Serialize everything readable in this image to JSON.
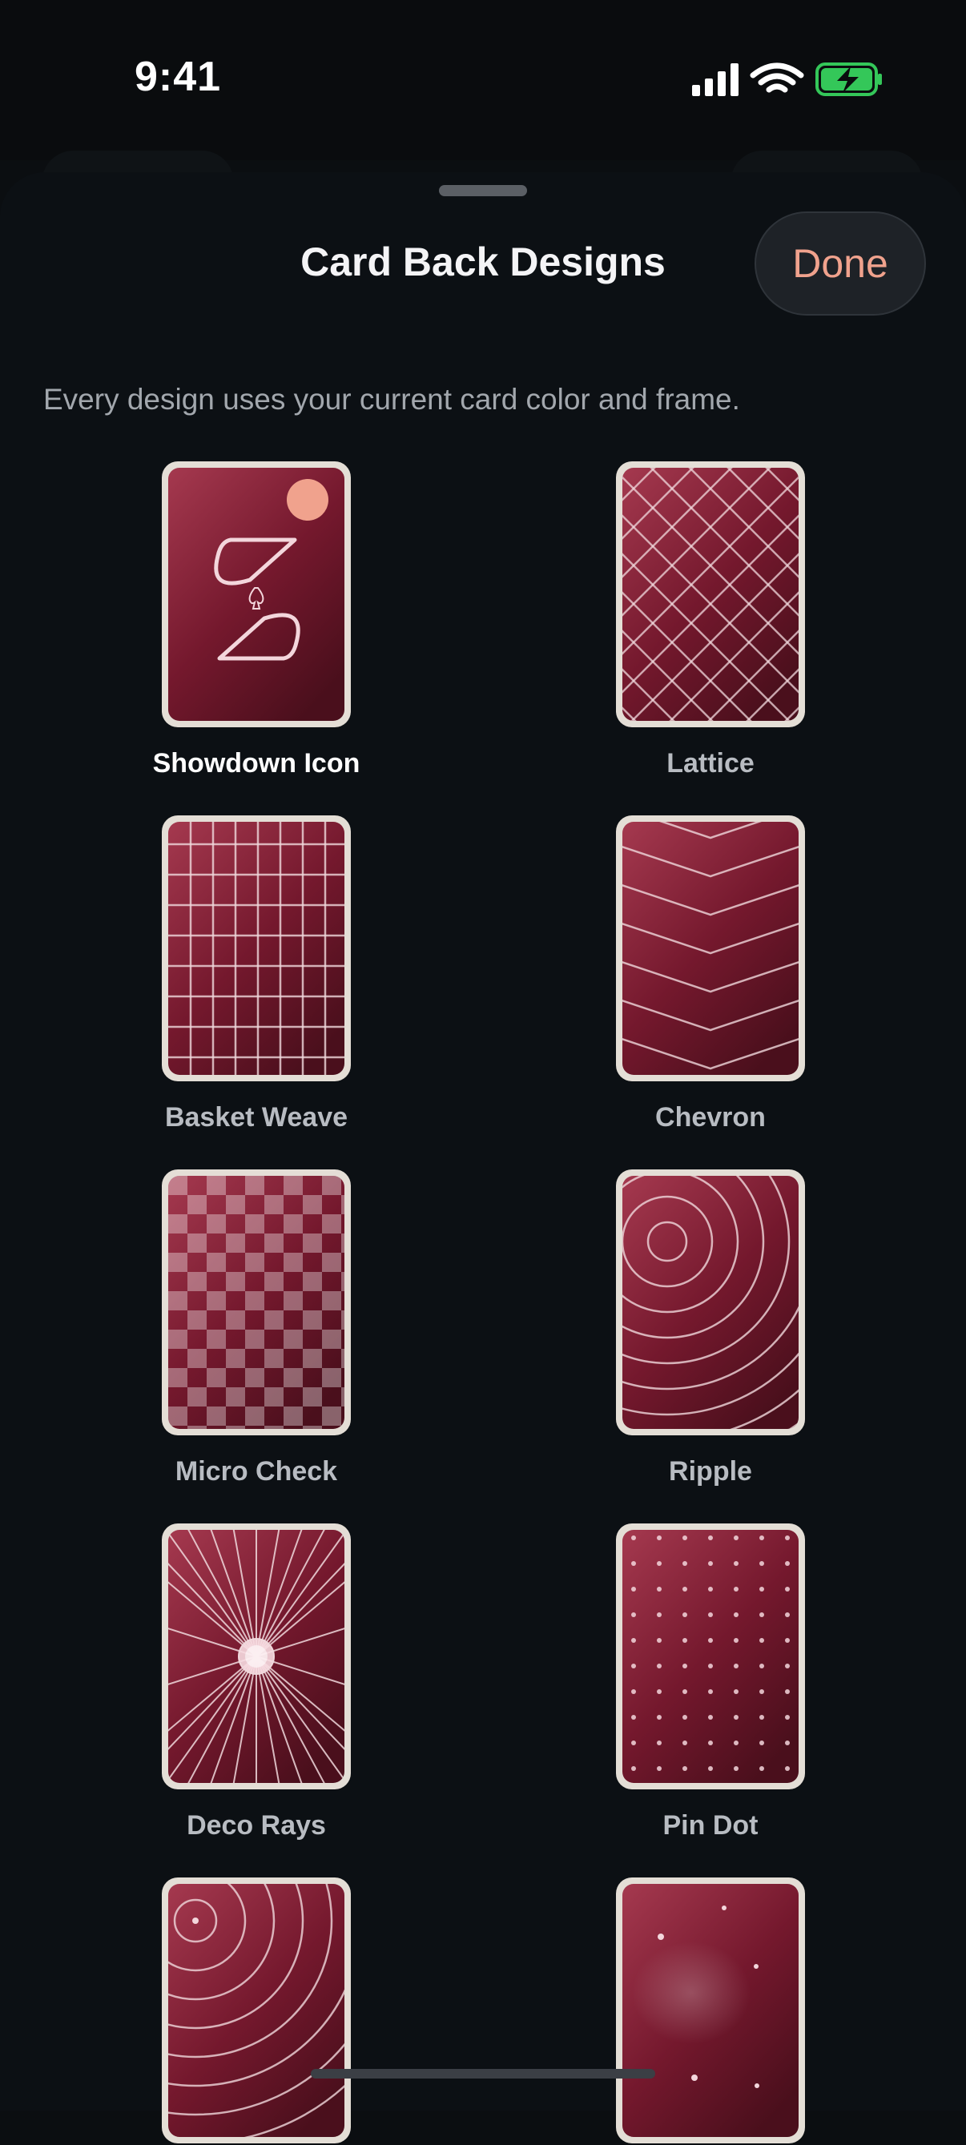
{
  "status": {
    "time": "9:41"
  },
  "sheet": {
    "title": "Card Back Designs",
    "done_label": "Done",
    "subtitle": "Every design uses your current card color and frame."
  },
  "designs": [
    {
      "label": "Showdown Icon",
      "icon": "showdown-logo",
      "selected": true
    },
    {
      "label": "Lattice",
      "icon": "lattice-pattern",
      "selected": false
    },
    {
      "label": "Basket Weave",
      "icon": "grid-pattern",
      "selected": false
    },
    {
      "label": "Chevron",
      "icon": "chevron-pattern",
      "selected": false
    },
    {
      "label": "Micro Check",
      "icon": "checker-pattern",
      "selected": false
    },
    {
      "label": "Ripple",
      "icon": "ripple-pattern",
      "selected": false
    },
    {
      "label": "Deco Rays",
      "icon": "rays-pattern",
      "selected": false
    },
    {
      "label": "Pin Dot",
      "icon": "dot-pattern",
      "selected": false
    },
    {
      "label": "",
      "icon": "ripple-corner-pattern",
      "selected": false
    },
    {
      "label": "",
      "icon": "starfield-pattern",
      "selected": false
    }
  ],
  "colors": {
    "card_top": "#a5394f",
    "card_bottom": "#4a0f1c",
    "frame": "#e4ded6",
    "accent": "#f0a28d",
    "background": "#0c1014"
  }
}
